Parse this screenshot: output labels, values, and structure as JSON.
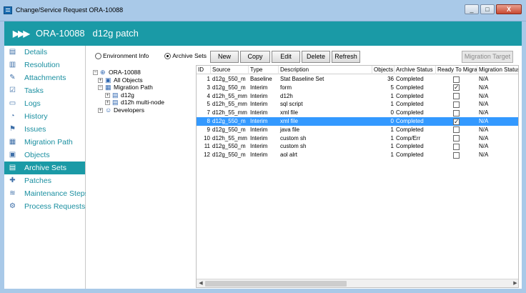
{
  "window": {
    "title": "Change/Service Request ORA-10088",
    "minimize": "_",
    "maximize": "□",
    "close": "X"
  },
  "header": {
    "chevrons": "▶▶▶",
    "title": "ORA-10088   d12g patch"
  },
  "sidebar": {
    "items": [
      {
        "label": "Details",
        "icon": "details-icon"
      },
      {
        "label": "Resolution",
        "icon": "resolution-icon"
      },
      {
        "label": "Attachments",
        "icon": "paperclip-icon"
      },
      {
        "label": "Tasks",
        "icon": "tasks-icon"
      },
      {
        "label": "Logs",
        "icon": "logs-icon"
      },
      {
        "label": "History",
        "icon": "clock-icon"
      },
      {
        "label": "Issues",
        "icon": "flag-icon"
      },
      {
        "label": "Migration Path",
        "icon": "migration-path-icon"
      },
      {
        "label": "Objects",
        "icon": "objects-icon"
      },
      {
        "label": "Archive Sets",
        "icon": "archive-icon"
      },
      {
        "label": "Patches",
        "icon": "patches-icon"
      },
      {
        "label": "Maintenance Steps",
        "icon": "maintenance-icon"
      },
      {
        "label": "Process Requests",
        "icon": "process-icon"
      }
    ],
    "active_index": 9
  },
  "view_options": {
    "environment_info": "Environment Info",
    "archive_sets": "Archive Sets",
    "selected": "archive_sets"
  },
  "tree": {
    "root": "ORA-10088",
    "all_objects": "All Objects",
    "migration_path": "Migration Path",
    "env1": "d12g",
    "env2": "d12h multi-node",
    "developers": "Developers"
  },
  "toolbar": {
    "new": "New",
    "copy": "Copy",
    "edit": "Edit",
    "delete": "Delete",
    "refresh": "Refresh",
    "migration_target": "Migration Target"
  },
  "grid": {
    "columns": [
      "ID",
      "Source",
      "Type",
      "Description",
      "Objects",
      "Archive Status",
      "Ready To Migrate",
      "Migration Status"
    ],
    "selected_row": 5,
    "rows": [
      {
        "id": "1",
        "source": "d12g_550_m",
        "type": "Baseline",
        "description": "Stat Baseline Set",
        "objects": "36",
        "status": "Completed",
        "ready": false,
        "migration": "N/A"
      },
      {
        "id": "3",
        "source": "d12g_550_m",
        "type": "Interim",
        "description": "form",
        "objects": "5",
        "status": "Completed",
        "ready": true,
        "migration": "N/A"
      },
      {
        "id": "4",
        "source": "d12h_55_mm",
        "type": "Interim",
        "description": "d12h",
        "objects": "1",
        "status": "Completed",
        "ready": false,
        "migration": "N/A"
      },
      {
        "id": "5",
        "source": "d12h_55_mm",
        "type": "Interim",
        "description": "sql script",
        "objects": "1",
        "status": "Completed",
        "ready": false,
        "migration": "N/A"
      },
      {
        "id": "7",
        "source": "d12h_55_mm",
        "type": "Interim",
        "description": "xml file",
        "objects": "0",
        "status": "Completed",
        "ready": false,
        "migration": "N/A"
      },
      {
        "id": "8",
        "source": "d12g_550_m",
        "type": "Interim",
        "description": "xml file",
        "objects": "0",
        "status": "Completed",
        "ready": true,
        "migration": "N/A"
      },
      {
        "id": "9",
        "source": "d12g_550_m",
        "type": "Interim",
        "description": "java file",
        "objects": "1",
        "status": "Completed",
        "ready": false,
        "migration": "N/A"
      },
      {
        "id": "10",
        "source": "d12h_55_mm",
        "type": "Interim",
        "description": "custom sh",
        "objects": "1",
        "status": "Comp/Err",
        "ready": false,
        "migration": "N/A"
      },
      {
        "id": "11",
        "source": "d12g_550_m",
        "type": "Interim",
        "description": "custom sh",
        "objects": "1",
        "status": "Completed",
        "ready": false,
        "migration": "N/A"
      },
      {
        "id": "12",
        "source": "d12g_550_m",
        "type": "Interim",
        "description": "aol alrt",
        "objects": "1",
        "status": "Completed",
        "ready": false,
        "migration": "N/A"
      }
    ]
  }
}
